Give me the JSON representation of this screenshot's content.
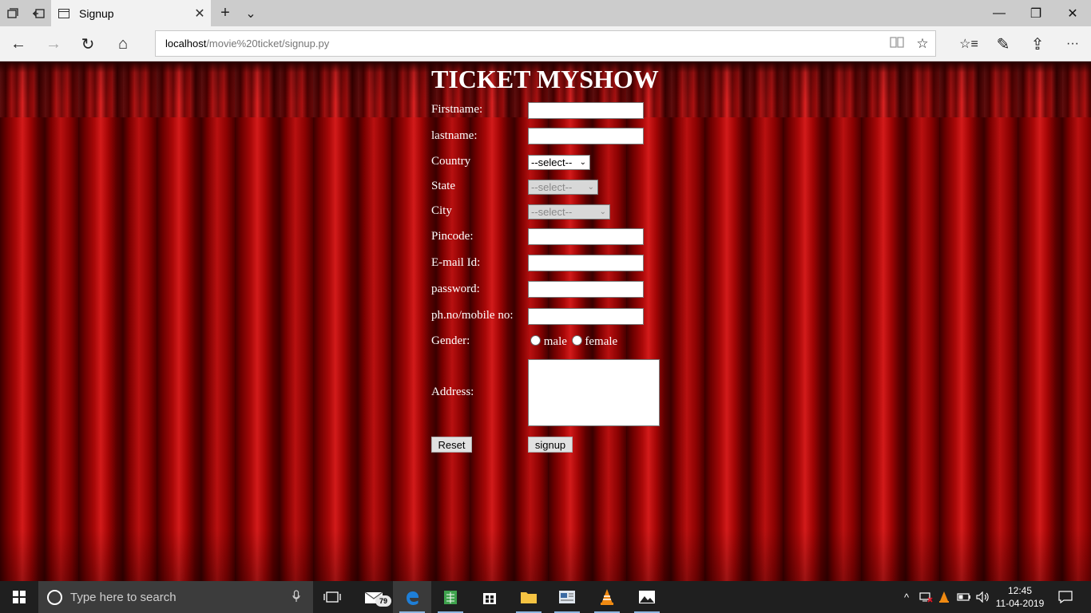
{
  "browser": {
    "tab_title": "Signup",
    "url_host": "localhost",
    "url_path": "/movie%20ticket/signup.py",
    "icons": {
      "tab_actions": "tab-actions-icon",
      "set_aside": "set-aside-tabs-icon",
      "new_tab": "+",
      "tab_list": "⌄",
      "close_tab": "✕",
      "minimize": "—",
      "restore": "❐",
      "close_window": "✕",
      "back": "←",
      "forward": "→",
      "refresh": "↻",
      "home": "⌂",
      "reading_view": "📖",
      "favorite": "☆",
      "favorites_hub": "☆≡",
      "notes": "✎",
      "share": "⇪",
      "more": "···"
    }
  },
  "form": {
    "title": "TICKET MYSHOW",
    "firstname_label": "Firstname:",
    "lastname_label": "lastname:",
    "country_label": "Country",
    "country_value": "--select--",
    "state_label": "State",
    "state_value": "--select--",
    "city_label": "City",
    "city_value": "--select--",
    "pincode_label": "Pincode:",
    "email_label": "E-mail Id:",
    "password_label": "password:",
    "phone_label": "ph.no/mobile no:",
    "gender_label": "Gender:",
    "gender_male": "male",
    "gender_female": "female",
    "address_label": "Address:",
    "reset_label": "Reset",
    "signup_label": "signup"
  },
  "taskbar": {
    "search_placeholder": "Type here to search",
    "mail_badge": "79",
    "time": "12:45",
    "date": "11-04-2019",
    "accent_color": "#8fb6e0"
  }
}
